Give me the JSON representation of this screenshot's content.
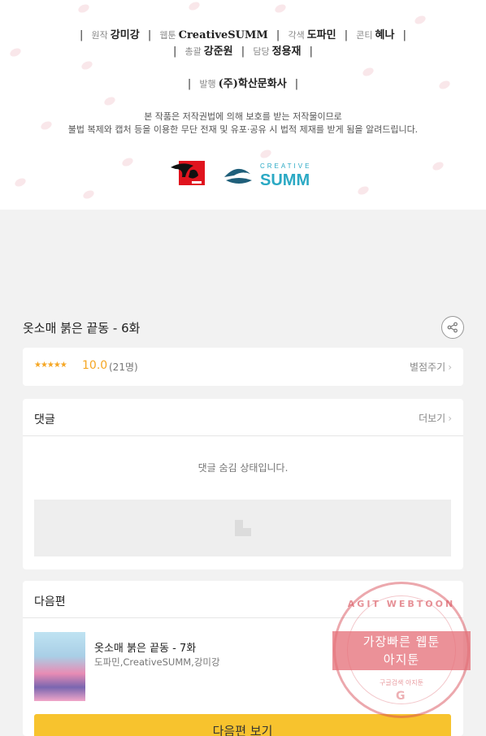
{
  "credits": {
    "line1": [
      {
        "role": "원작",
        "name": "강미강"
      },
      {
        "role": "웹툰",
        "name": "CreativeSUMM"
      },
      {
        "role": "각색",
        "name": "도파민"
      },
      {
        "role": "콘티",
        "name": "혜나"
      }
    ],
    "line2": [
      {
        "role": "총괄",
        "name": "강준원"
      },
      {
        "role": "담당",
        "name": "정용재"
      }
    ],
    "publisher": {
      "role": "발행",
      "name": "(주)학산문화사"
    },
    "notice_line1": "본 작품은 저작권법에 의해 보호를 받는 저작물이므로",
    "notice_line2": "불법 복제와 캡처 등을 이용한 무단 전재 및 유포·공유 시 법적 제재를 받게 됨을 알려드립니다.",
    "logo_right_top": "CREATIVE",
    "logo_right_bottom": "SUMM",
    "logo_left_icon": "haksan-logo-icon"
  },
  "episode": {
    "title": "옷소매 붉은 끝동 - 6화",
    "share_icon": "share-icon"
  },
  "rating": {
    "stars": "★★★★★",
    "score": "10.0",
    "count": "(21명)",
    "rate_link": "별점주기",
    "chevron": "›"
  },
  "comments": {
    "heading": "댓글",
    "more_link": "더보기",
    "chevron": "›",
    "hidden_message": "댓글 숨김 상태입니다."
  },
  "next_episode": {
    "heading": "다음편",
    "title": "옷소매 붉은 끝동 - 7화",
    "authors": "도파민,CreativeSUMM,강미강",
    "button_label": "다음편 보기"
  },
  "watermark": {
    "top_text": "AGIT WEBTOON",
    "line1": "가장빠른 웹툰",
    "line2": "아지툰",
    "bottom_text": "구글검색      아지툰",
    "g_letter": "G"
  },
  "colors": {
    "accent_star": "#f5a623",
    "button_yellow": "#f7c32e",
    "stamp_red": "#d64650"
  }
}
